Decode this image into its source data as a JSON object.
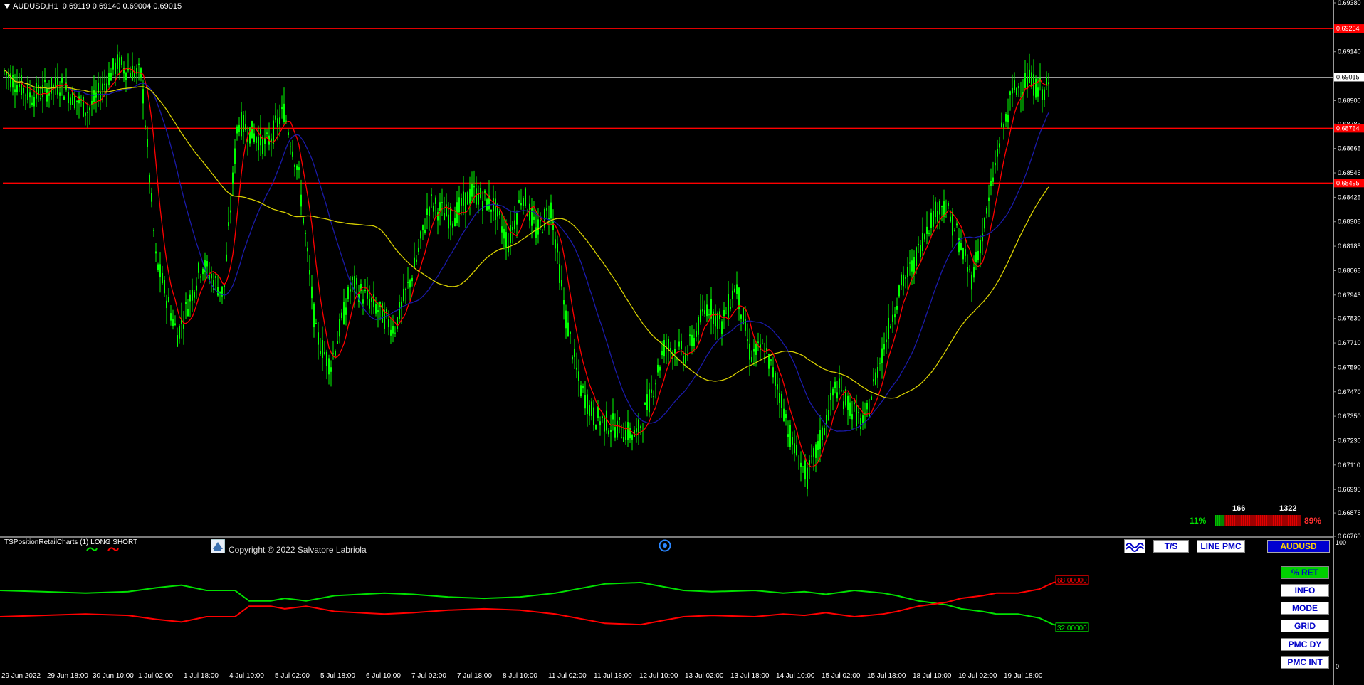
{
  "header": {
    "symbol_timeframe": "AUDUSD,H1",
    "ohlc": "0.69119 0.69140 0.69004 0.69015"
  },
  "price_scale": {
    "labels": [
      "0.69380",
      "0.69140",
      "0.68900",
      "0.68785",
      "0.68665",
      "0.68545",
      "0.68425",
      "0.68305",
      "0.68185",
      "0.68065",
      "0.67945",
      "0.67830",
      "0.67710",
      "0.67590",
      "0.67470",
      "0.67350",
      "0.67230",
      "0.67110",
      "0.66990",
      "0.66875",
      "0.66760"
    ],
    "current_price_label": "0.69015",
    "levels": [
      {
        "label": "0.69254",
        "price": 0.69254,
        "color": "#ff0000"
      },
      {
        "label": "0.68764",
        "price": 0.68764,
        "color": "#ff0000"
      },
      {
        "label": "0.68495",
        "price": 0.68495,
        "color": "#ff0000"
      }
    ],
    "current_price": 0.69015,
    "range": [
      0.6676,
      0.6938
    ]
  },
  "time_axis": {
    "labels": [
      "29 Jun 2022",
      "29 Jun 18:00",
      "30 Jun 10:00",
      "1 Jul 02:00",
      "1 Jul 18:00",
      "4 Jul 10:00",
      "5 Jul 02:00",
      "5 Jul 18:00",
      "6 Jul 10:00",
      "7 Jul 02:00",
      "7 Jul 18:00",
      "8 Jul 10:00",
      "11 Jul 02:00",
      "11 Jul 18:00",
      "12 Jul 10:00",
      "13 Jul 02:00",
      "13 Jul 18:00",
      "14 Jul 10:00",
      "15 Jul 02:00",
      "15 Jul 18:00",
      "18 Jul 10:00",
      "19 Jul 02:00",
      "19 Jul 18:00"
    ]
  },
  "indicator": {
    "title": "TSPositionRetailCharts (1) LONG SHORT",
    "copyright": "Copyright © 2022 Salvatore Labriola",
    "scale_top": "100",
    "scale_bottom": "0",
    "short_value_label": "68.00000",
    "long_value_label": "32.00000",
    "long_color": "#00e000",
    "short_color": "#ff0000"
  },
  "ratio_widget": {
    "long_pct": "11%",
    "short_pct": "89%",
    "long_count": "166",
    "short_count": "1322",
    "long_fraction": 0.11
  },
  "buttons": {
    "ts": "T/S",
    "line_pmc": "LINE PMC",
    "symbol": "AUDUSD",
    "pct_ret": "% RET",
    "info": "INFO",
    "mode": "MODE",
    "grid": "GRID",
    "pmc_dy": "PMC DY",
    "pmc_int": "PMC INT"
  },
  "icons": {
    "wave": "wave-chart-icon",
    "target": "target-icon",
    "logo": "author-logo-icon"
  },
  "colors": {
    "candle": "#00ff00",
    "ma_fast": "#ff0000",
    "ma_mid": "#1a1aa8",
    "ma_slow": "#d8d000",
    "background": "#000000"
  }
}
